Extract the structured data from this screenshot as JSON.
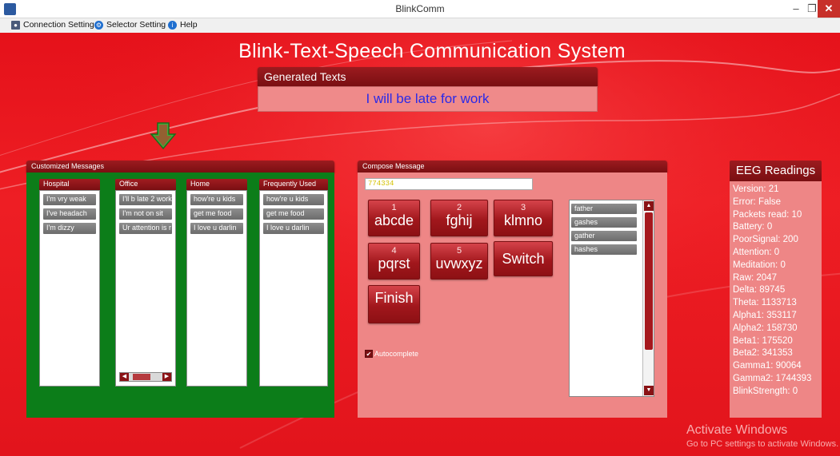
{
  "window": {
    "title": "BlinkComm",
    "minimize_glyph": "–",
    "maximize_glyph": "❐",
    "close_glyph": "✕"
  },
  "menu": {
    "items": [
      {
        "label": "Connection Setting",
        "icon": "connection-icon"
      },
      {
        "label": "Selector Setting",
        "icon": "settings-icon"
      },
      {
        "label": "Help",
        "icon": "info-icon"
      }
    ]
  },
  "app_title": "Blink-Text-Speech Communication System",
  "generated": {
    "header": "Generated  Texts",
    "text": "I will be late for work"
  },
  "indicator": {
    "icon": "down-arrow-icon",
    "color": "#2ea12e"
  },
  "customized": {
    "header": "Customized Messages",
    "columns": [
      {
        "title": "Hospital",
        "items": [
          "I'm vry weak",
          "I've headach",
          "I'm dizzy"
        ]
      },
      {
        "title": "Office",
        "items": [
          "I'll b late 2 work",
          "I'm not on sit",
          "Ur attention is r"
        ]
      },
      {
        "title": "Home",
        "items": [
          "how're u kids",
          "get me food",
          "I love u darlin"
        ]
      },
      {
        "title": "Frequently Used",
        "items": [
          "how're u kids",
          "get me food",
          "I love u darlin"
        ]
      }
    ],
    "scroll_left": "◀",
    "scroll_right": "▶"
  },
  "compose": {
    "header": "Compose Message",
    "input_value": "774334",
    "keys": [
      {
        "num": "1",
        "label": "abcde"
      },
      {
        "num": "2",
        "label": "fghij"
      },
      {
        "num": "3",
        "label": "klmno"
      },
      {
        "num": "4",
        "label": "pqrst"
      },
      {
        "num": "5",
        "label": "uvwxyz"
      }
    ],
    "switch_label": "Switch",
    "finish_label": "Finish",
    "suggestions": [
      "father",
      "gashes",
      "gather",
      "hashes"
    ],
    "scroll_up": "▲",
    "scroll_down": "▼",
    "autocomplete_label": "Autocomplete",
    "autocomplete_checked": "✔"
  },
  "eeg": {
    "header": "EEG Readings",
    "lines": [
      "Version: 21",
      "Error: False",
      "Packets read: 10",
      "Battery: 0",
      "PoorSignal: 200",
      "Attention: 0",
      "Meditation: 0",
      "Raw: 2047",
      "Delta: 89745",
      "Theta: 1133713",
      "Alpha1: 353117",
      "Alpha2: 158730",
      "Beta1: 175520",
      "Beta2: 341353",
      "Gamma1: 90064",
      "Gamma2: 1744393",
      "BlinkStrength: 0"
    ]
  },
  "activation": {
    "title": "Activate Windows",
    "subtitle": "Go to PC settings to activate Windows."
  }
}
